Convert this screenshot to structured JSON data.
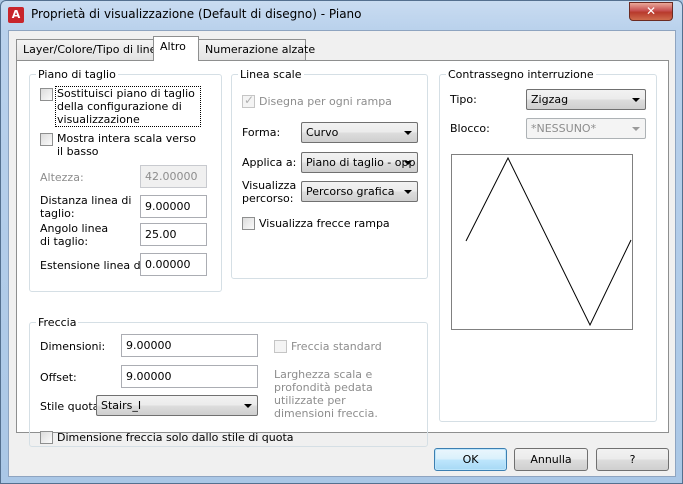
{
  "window": {
    "title": "Proprietà di visualizzazione (Default di disegno) - Piano",
    "app_icon_letter": "A",
    "close_glyph": "✕"
  },
  "tabs": [
    {
      "label": "Layer/Colore/Tipo di linea",
      "active": false
    },
    {
      "label": "Altro",
      "active": true
    },
    {
      "label": "Numerazione alzate",
      "active": false
    }
  ],
  "cut_plane": {
    "title": "Piano di taglio",
    "override_label": "Sostituisci piano di taglio della configurazione di visualizzazione",
    "override_checked": false,
    "full_scale_label": "Mostra intera scala verso il basso",
    "full_scale_checked": false,
    "height_label": "Altezza:",
    "height_value": "42.00000",
    "distance_label": "Distanza linea di taglio:",
    "distance_value": "9.00000",
    "angle_label": "Angolo linea di taglio:",
    "angle_value": "25.00",
    "extension_label": "Estensione linea di",
    "extension_value": "0.00000"
  },
  "line_scale": {
    "title": "Linea scale",
    "draw_each_label": "Disegna per ogni rampa",
    "draw_each_checked": true,
    "shape_label": "Forma:",
    "shape_value": "Curvo",
    "apply_label": "Applica a:",
    "apply_value": "Piano di taglio - opp",
    "path_label": "Visualizza percorso:",
    "path_value": "Percorso grafica",
    "arrows_label": "Visualizza frecce rampa",
    "arrows_checked": false
  },
  "break_mark": {
    "title": "Contrassegno interruzione",
    "type_label": "Tipo:",
    "type_value": "Zigzag",
    "block_label": "Blocco:",
    "block_value": "*NESSUNO*"
  },
  "arrow": {
    "title": "Freccia",
    "size_label": "Dimensioni:",
    "size_value": "9.00000",
    "offset_label": "Offset:",
    "offset_value": "9.00000",
    "style_label": "Stile quota:",
    "style_value": "Stairs_I",
    "standard_label": "Freccia standard",
    "standard_checked": false,
    "info_text": "Larghezza scala e profondità pedata utilizzate per dimensioni freccia.",
    "style_only_label": "Dimensione freccia solo dallo stile di quota",
    "style_only_checked": false
  },
  "buttons": {
    "ok": "OK",
    "cancel": "Annulla",
    "help": "?"
  }
}
